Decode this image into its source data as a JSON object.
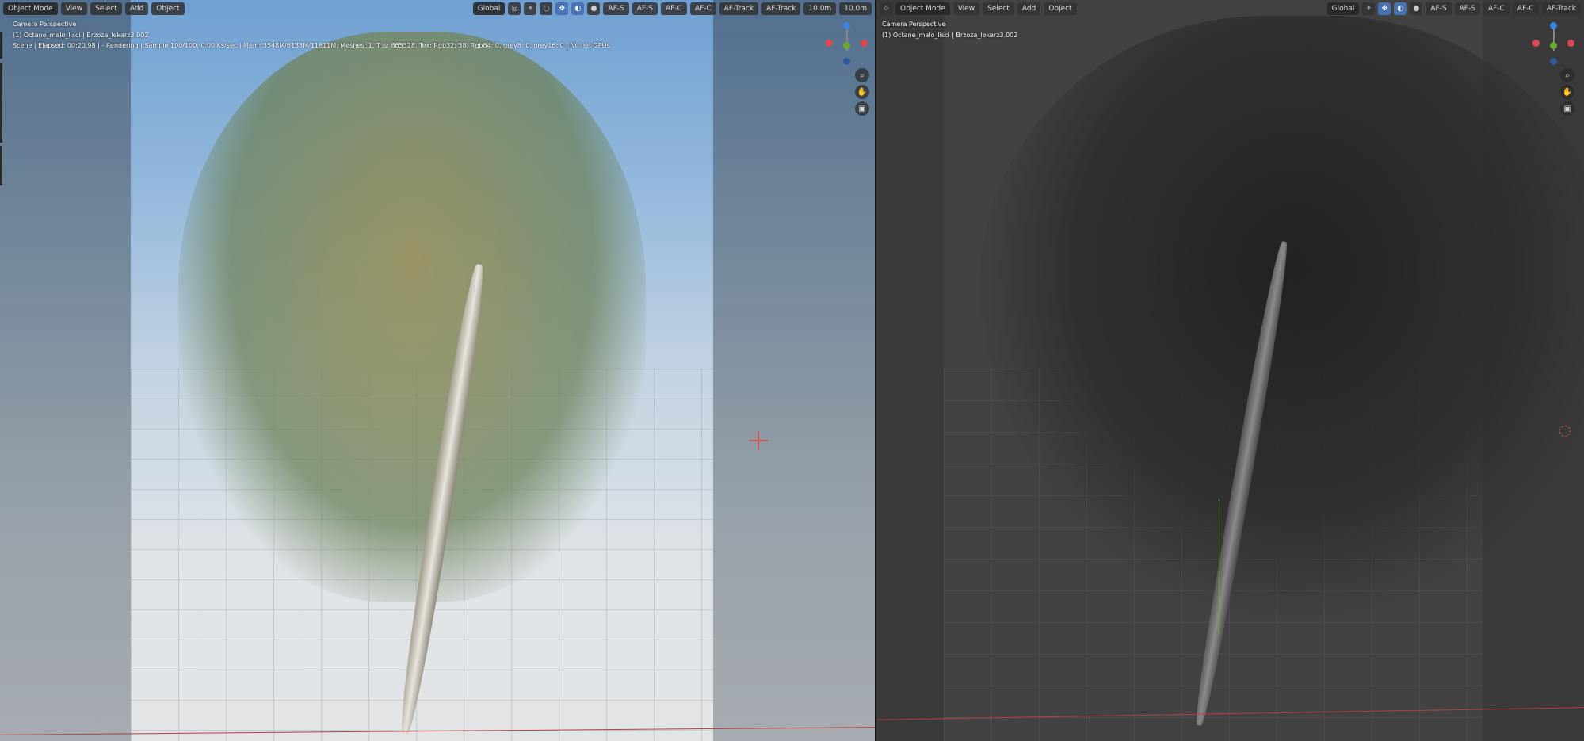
{
  "left": {
    "header": {
      "mode": "Object Mode",
      "menus": [
        "View",
        "Select",
        "Add",
        "Object"
      ],
      "transform": "Global",
      "cams": [
        "AF-S",
        "AF-S",
        "AF-C",
        "AF-C",
        "AF-Track",
        "AF-Track"
      ],
      "clip_a": "10.0m",
      "clip_b": "10.0m"
    },
    "overlay": {
      "view": "Camera Perspective",
      "object": "(1) Octane_malo_lisci | Brzoza_lekarz3.002",
      "stats": "Scene | Elapsed: 00:20.98 | - Rendering | Sample 100/100, 0.00 Ks/sec | Mem: 3548M/6133M/11811M, Meshes: 1, Tris: 865328, Tex: Rgb32: 38, Rgb64: 0, grey8: 0, grey16: 0 | No net GPUs"
    }
  },
  "right": {
    "header": {
      "mode": "Object Mode",
      "menus": [
        "View",
        "Select",
        "Add",
        "Object"
      ],
      "transform": "Global",
      "cams": [
        "AF-S",
        "AF-S",
        "AF-C",
        "AF-C",
        "AF-Track"
      ]
    },
    "overlay": {
      "view": "Camera Perspective",
      "object": "(1) Octane_malo_lisci | Brzoza_lekarz3.002"
    }
  },
  "colors": {
    "axis_x": "#e0474f",
    "axis_y": "#6ea832",
    "axis_z": "#3b84e0",
    "accent": "#4772b3"
  },
  "icons": [
    "zoom-icon",
    "hand-icon",
    "camera-icon",
    "cursor-3d-icon",
    "snap-icon",
    "viewport-shading-icon"
  ]
}
